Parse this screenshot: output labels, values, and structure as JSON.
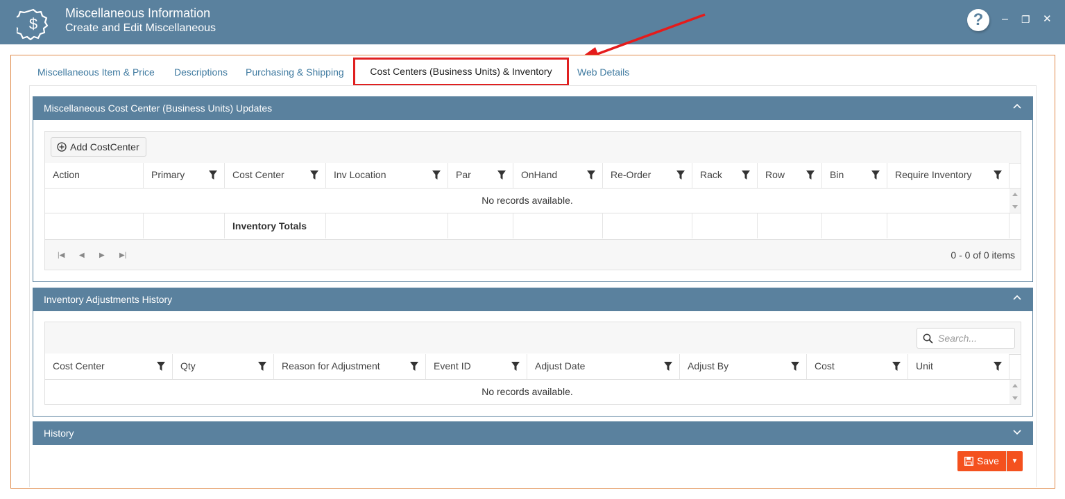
{
  "header": {
    "title": "Miscellaneous Information",
    "subtitle": "Create and Edit Miscellaneous",
    "help_label": "?",
    "minimize_label": "–",
    "maximize_label": "❐",
    "close_label": "✕",
    "logo_icon": "dollar-badge-icon"
  },
  "tabs": [
    {
      "label": "Miscellaneous Item & Price"
    },
    {
      "label": "Descriptions"
    },
    {
      "label": "Purchasing & Shipping"
    },
    {
      "label": "Cost Centers (Business Units) & Inventory"
    },
    {
      "label": "Web Details"
    }
  ],
  "cost_center_panel": {
    "title": "Miscellaneous Cost Center (Business Units) Updates",
    "add_button": "Add CostCenter",
    "columns": [
      "Action",
      "Primary",
      "Cost Center",
      "Inv Location",
      "Par",
      "OnHand",
      "Re-Order",
      "Rack",
      "Row",
      "Bin",
      "Require Inventory"
    ],
    "no_records": "No records available.",
    "totals_label": "Inventory Totals",
    "pager_info": "0 - 0 of 0 items"
  },
  "adjustments_panel": {
    "title": "Inventory Adjustments History",
    "search_placeholder": "Search...",
    "columns": [
      "Cost Center",
      "Qty",
      "Reason for Adjustment",
      "Event ID",
      "Adjust Date",
      "Adjust By",
      "Cost",
      "Unit"
    ],
    "no_records": "No records available."
  },
  "history_panel": {
    "title": "History"
  },
  "save_button": {
    "label": "Save"
  },
  "colors": {
    "header_bg": "#5a819e",
    "tab_link": "#3f7aa0",
    "highlight_border": "#e02020",
    "save_bg": "#f4511e",
    "frame_border": "#e08a4a"
  }
}
